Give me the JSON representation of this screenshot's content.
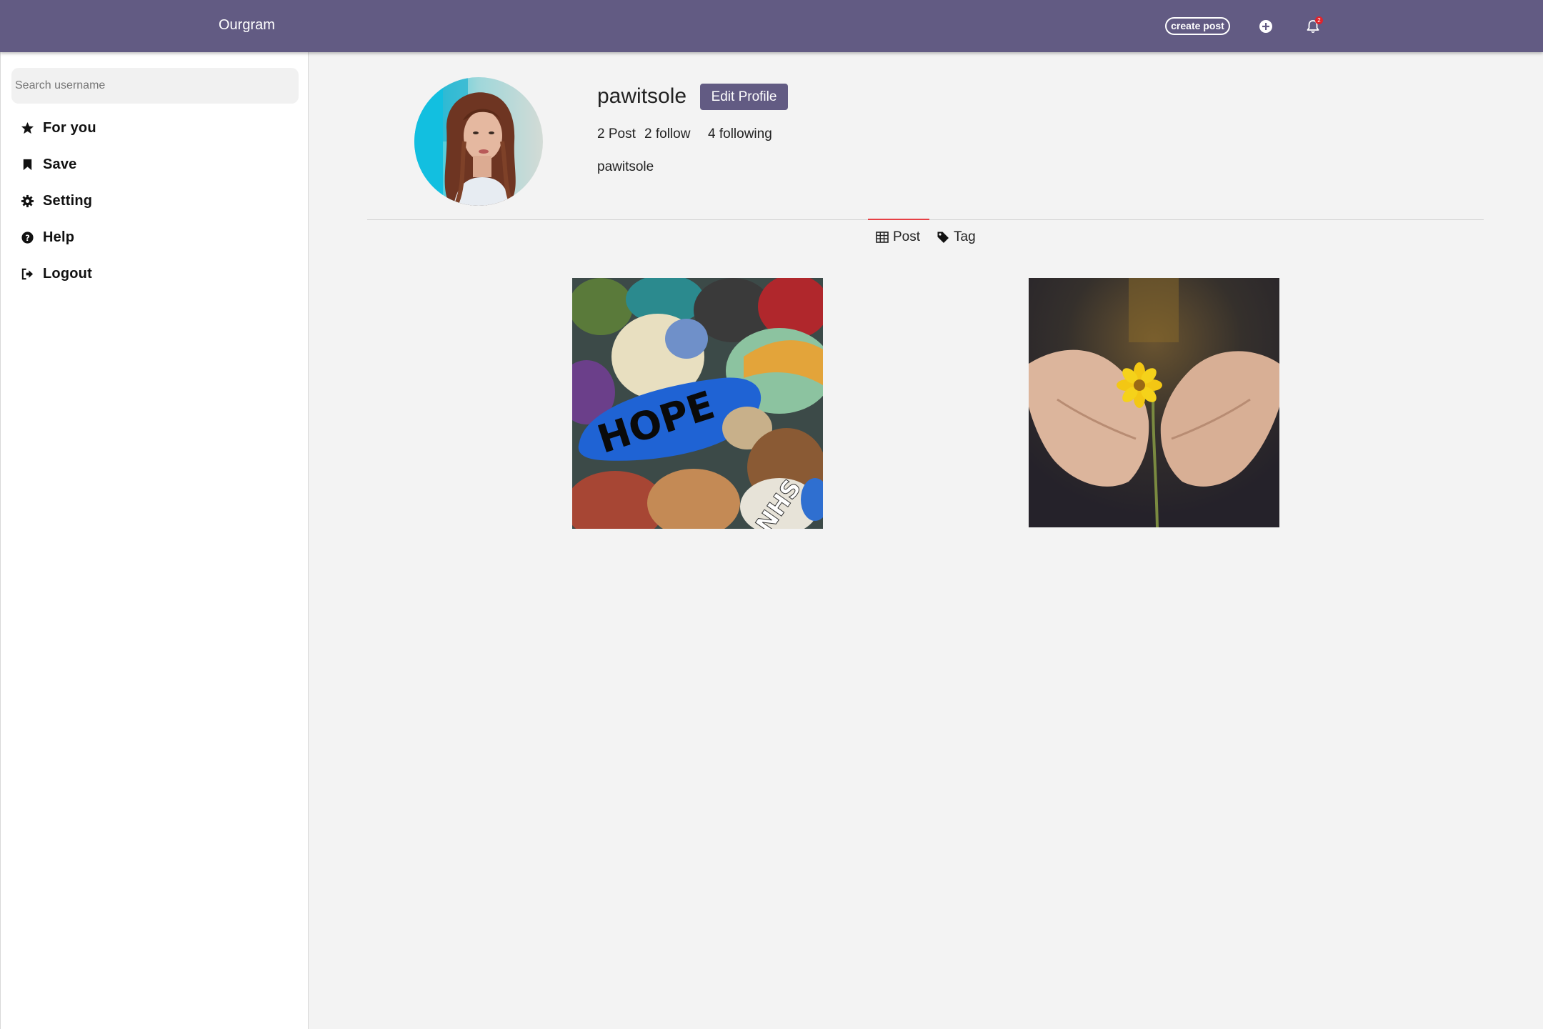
{
  "header": {
    "brand": "Ourgram",
    "create_post_label": "create post",
    "notification_count": "2",
    "plus_icon": "plus-circle-icon",
    "bell_icon": "bell-icon"
  },
  "sidebar": {
    "search_placeholder": "Search username",
    "items": [
      {
        "label": "For you",
        "icon": "star-icon"
      },
      {
        "label": "Save",
        "icon": "bookmark-icon"
      },
      {
        "label": "Setting",
        "icon": "gear-icon"
      },
      {
        "label": "Help",
        "icon": "question-circle-icon"
      },
      {
        "label": "Logout",
        "icon": "sign-out-icon"
      }
    ]
  },
  "profile": {
    "username": "pawitsole",
    "edit_label": "Edit Profile",
    "posts": "2 Post",
    "followers": "2 follow",
    "following": "4 following",
    "bio": "pawitsole"
  },
  "tabs": [
    {
      "label": "Post",
      "icon": "grid-icon",
      "active": true
    },
    {
      "label": "Tag",
      "icon": "tag-icon",
      "active": false
    }
  ],
  "posts": [
    {
      "image": "painted-rocks-photo",
      "caption_on_image": "HOPE",
      "secondary_text": "NHS"
    },
    {
      "image": "hands-holding-flower-photo"
    }
  ],
  "colors": {
    "primary": "#625b83",
    "background": "#f3f3f3",
    "tab_accent": "#e64045",
    "badge": "#e0242c"
  }
}
